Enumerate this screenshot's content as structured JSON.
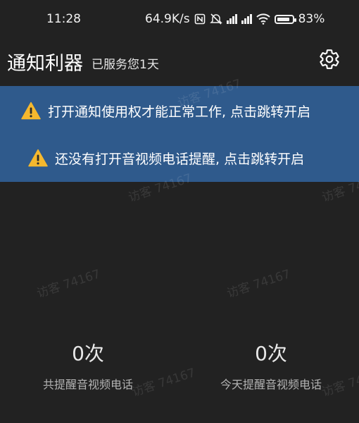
{
  "status_bar": {
    "time": "11:28",
    "net_speed": "64.9K/s",
    "battery_percent": "83%",
    "battery_level": 0.83,
    "icons": [
      "nfc-icon",
      "mute-icon",
      "hd-signal-icon",
      "hd-signal-icon",
      "wifi-icon",
      "battery-icon"
    ]
  },
  "header": {
    "title": "通知利器",
    "subtitle": "已服务您1天",
    "settings_icon": "gear-icon"
  },
  "banner": {
    "items": [
      {
        "text": "打开通知使用权才能正常工作, 点击跳转开启",
        "icon": "warning-icon"
      },
      {
        "text": "还没有打开音视频电话提醒, 点击跳转开启",
        "icon": "warning-icon"
      }
    ],
    "color": "#2f5a8c",
    "warning_color": "#f5b82e"
  },
  "stats": [
    {
      "value": "0次",
      "label": "共提醒音视频电话"
    },
    {
      "value": "0次",
      "label": "今天提醒音视频电话"
    }
  ],
  "watermark": "访客 74167"
}
